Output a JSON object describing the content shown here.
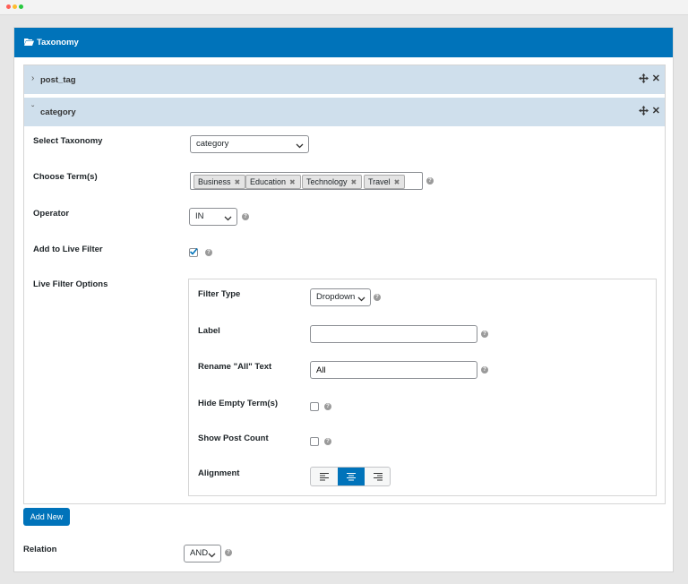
{
  "panel": {
    "title": "Taxonomy"
  },
  "accordions": [
    {
      "name": "post_tag",
      "expanded": false
    },
    {
      "name": "category",
      "expanded": true
    }
  ],
  "fields": {
    "select_taxonomy": {
      "label": "Select Taxonomy",
      "value": "category"
    },
    "choose_terms": {
      "label": "Choose Term(s)",
      "tags": [
        "Business",
        "Education",
        "Technology",
        "Travel"
      ]
    },
    "operator": {
      "label": "Operator",
      "value": "IN"
    },
    "add_live_filter": {
      "label": "Add to Live Filter",
      "checked": true
    },
    "live_filter_options": {
      "label": "Live Filter Options"
    }
  },
  "live_filter": {
    "filter_type": {
      "label": "Filter Type",
      "value": "Dropdown"
    },
    "label_field": {
      "label": "Label",
      "value": ""
    },
    "rename_all": {
      "label": "Rename \"All\" Text",
      "value": "All"
    },
    "hide_empty": {
      "label": "Hide Empty Term(s)",
      "checked": false
    },
    "show_count": {
      "label": "Show Post Count",
      "checked": false
    },
    "alignment": {
      "label": "Alignment",
      "selected": "center"
    }
  },
  "add_new_label": "Add New",
  "relation": {
    "label": "Relation",
    "value": "AND"
  },
  "colors": {
    "primary": "#0073ba",
    "accordion_bg": "#cfdfec"
  }
}
